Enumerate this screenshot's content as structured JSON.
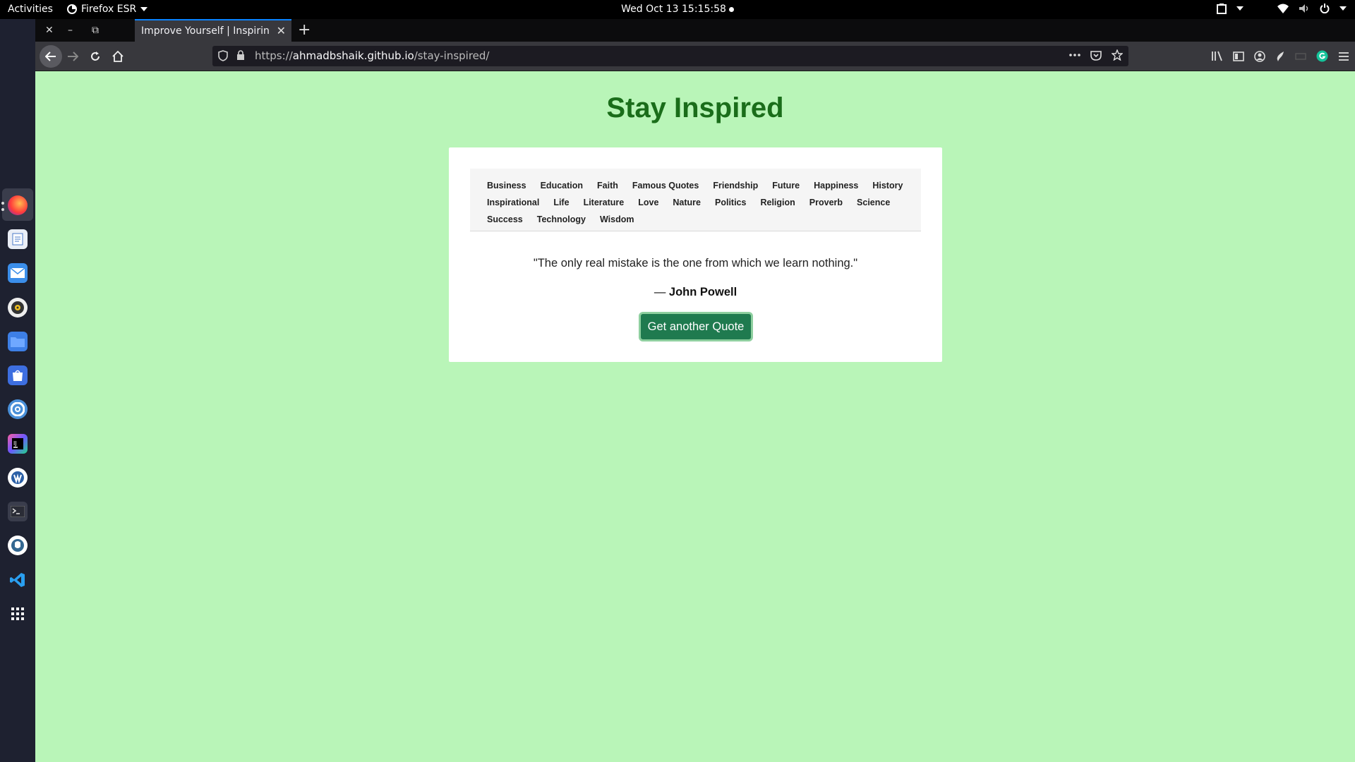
{
  "system": {
    "activities_label": "Activities",
    "app_name": "Firefox ESR",
    "clock": "Wed Oct 13  15:15:58"
  },
  "dock": {
    "icons": [
      "firefox-icon",
      "text-editor-icon",
      "mail-icon",
      "music-player-icon",
      "files-icon",
      "software-store-icon",
      "help-icon",
      "intellij-icon",
      "inkscape-icon",
      "terminal-icon",
      "pgadmin-icon",
      "vscode-icon",
      "app-grid-icon"
    ]
  },
  "browser": {
    "tab_title": "Improve Yourself | Inspiring",
    "url_prefix": "https://",
    "url_host": "ahmadbshaik.github.io",
    "url_path": "/stay-inspired/",
    "accent": "#0a84ff"
  },
  "page": {
    "title": "Stay Inspired",
    "category_rows": [
      [
        "Business",
        "Education",
        "Faith",
        "Famous Quotes",
        "Friendship",
        "Future",
        "Happiness",
        "History"
      ],
      [
        "Inspirational",
        "Life",
        "Literature",
        "Love",
        "Nature",
        "Politics",
        "Religion",
        "Proverb",
        "Science"
      ],
      [
        "Success",
        "Technology",
        "Wisdom"
      ]
    ],
    "quote": "\"The only real mistake is the one from which we learn nothing.\"",
    "author_dash": "— ",
    "author": "John Powell",
    "button_label": "Get another Quote",
    "colors": {
      "background": "#b9f5b8",
      "title": "#1a6d1a",
      "button": "#1f7a4f"
    }
  }
}
